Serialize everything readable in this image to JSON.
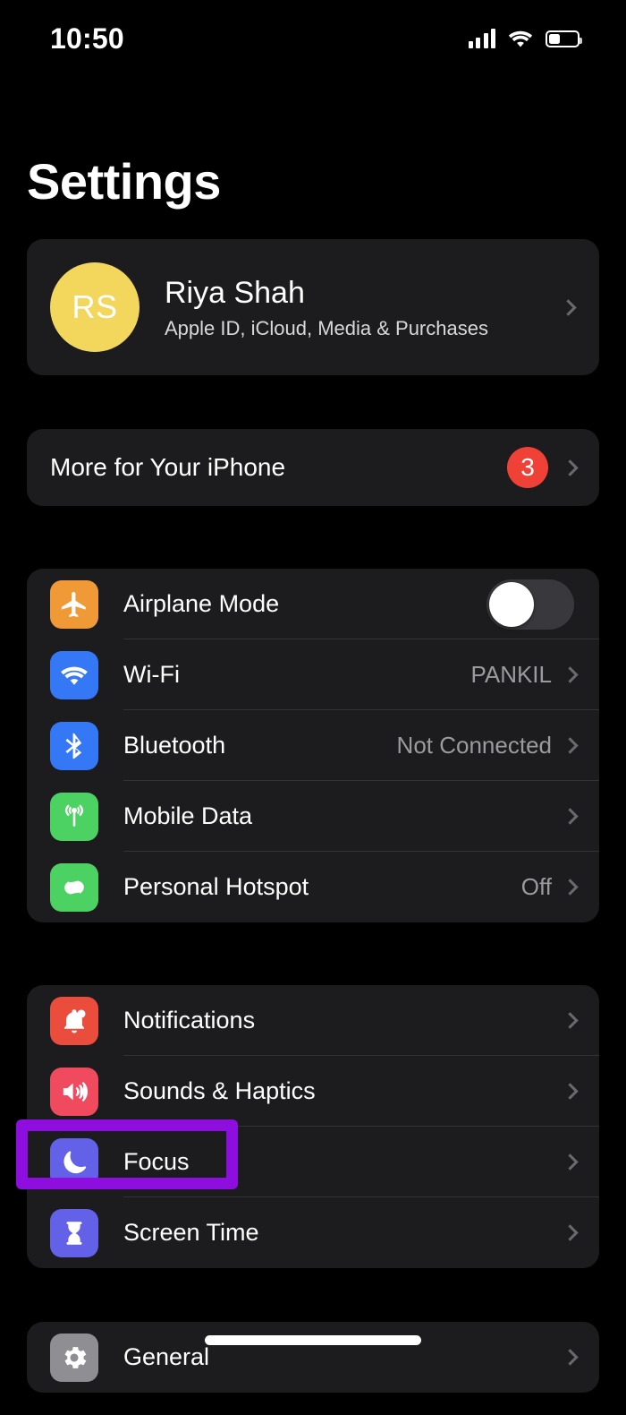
{
  "status_bar": {
    "time": "10:50",
    "cellular_icon": "signal-bars-icon",
    "wifi_icon": "wifi-icon",
    "battery_icon": "battery-icon",
    "battery_level_percent": 34
  },
  "page_title": "Settings",
  "account": {
    "initials": "RS",
    "name": "Riya Shah",
    "subtitle": "Apple ID, iCloud, Media & Purchases",
    "avatar_color": "#f3d65c",
    "chevron": "chevron-right-icon"
  },
  "promo": {
    "label": "More for Your iPhone",
    "badge": "3",
    "badge_color": "#ef4136"
  },
  "connectivity": [
    {
      "label": "Airplane Mode",
      "icon": "airplane-icon",
      "icon_color": "#f09a37",
      "control": "toggle",
      "toggle_on": false,
      "value": ""
    },
    {
      "label": "Wi-Fi",
      "icon": "wifi-icon",
      "icon_color": "#3478f6",
      "control": "chevron",
      "value": "PANKIL"
    },
    {
      "label": "Bluetooth",
      "icon": "bluetooth-icon",
      "icon_color": "#3478f6",
      "control": "chevron",
      "value": "Not Connected"
    },
    {
      "label": "Mobile Data",
      "icon": "cellular-antenna-icon",
      "icon_color": "#4cd263",
      "control": "chevron",
      "value": ""
    },
    {
      "label": "Personal Hotspot",
      "icon": "hotspot-link-icon",
      "icon_color": "#4cd263",
      "control": "chevron",
      "value": "Off"
    }
  ],
  "preferences": [
    {
      "label": "Notifications",
      "icon": "bell-icon",
      "icon_color": "#eb4d3d",
      "value": ""
    },
    {
      "label": "Sounds & Haptics",
      "icon": "speaker-waves-icon",
      "icon_color": "#ef4a5e",
      "value": ""
    },
    {
      "label": "Focus",
      "icon": "moon-icon",
      "icon_color": "#6361e8",
      "value": "",
      "highlighted": true
    },
    {
      "label": "Screen Time",
      "icon": "hourglass-icon",
      "icon_color": "#6361e8",
      "value": ""
    }
  ],
  "system": [
    {
      "label": "General",
      "icon": "gear-icon",
      "icon_color": "#8e8e93",
      "value": ""
    }
  ],
  "annotation": {
    "target": "Focus",
    "color": "#8e0ee0",
    "shape": "rectangle"
  }
}
